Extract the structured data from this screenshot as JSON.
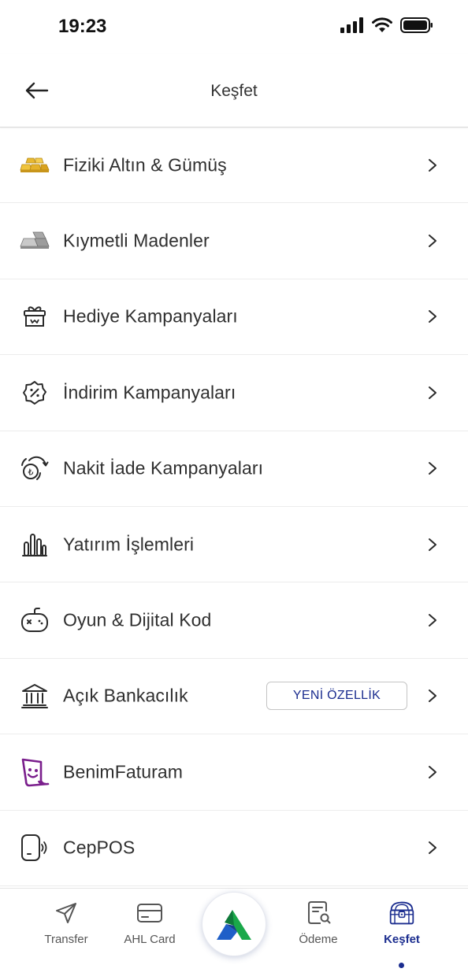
{
  "status": {
    "time": "19:23"
  },
  "header": {
    "title": "Keşfet"
  },
  "menu": {
    "items": [
      {
        "label": "Fiziki Altın & Gümüş",
        "icon": "gold-bars-icon"
      },
      {
        "label": "Kıymetli Madenler",
        "icon": "silver-bars-icon"
      },
      {
        "label": "Hediye Kampanyaları",
        "icon": "gift-icon"
      },
      {
        "label": "İndirim Kampanyaları",
        "icon": "discount-badge-icon"
      },
      {
        "label": "Nakit İade Kampanyaları",
        "icon": "cashback-icon"
      },
      {
        "label": "Yatırım İşlemleri",
        "icon": "bar-chart-icon"
      },
      {
        "label": "Oyun & Dijital Kod",
        "icon": "gamepad-icon"
      },
      {
        "label": "Açık Bankacılık",
        "icon": "bank-icon",
        "badge": "YENİ ÖZELLİK"
      },
      {
        "label": "BenimFaturam",
        "icon": "invoice-face-icon"
      },
      {
        "label": "CepPOS",
        "icon": "contactless-phone-icon"
      }
    ]
  },
  "tabs": {
    "transfer": "Transfer",
    "card": "AHL Card",
    "payment": "Ödeme",
    "explore": "Keşfet"
  },
  "colors": {
    "accent": "#1b2d8f",
    "brand_green": "#1aa84a",
    "brand_blue": "#1f5fc8"
  }
}
